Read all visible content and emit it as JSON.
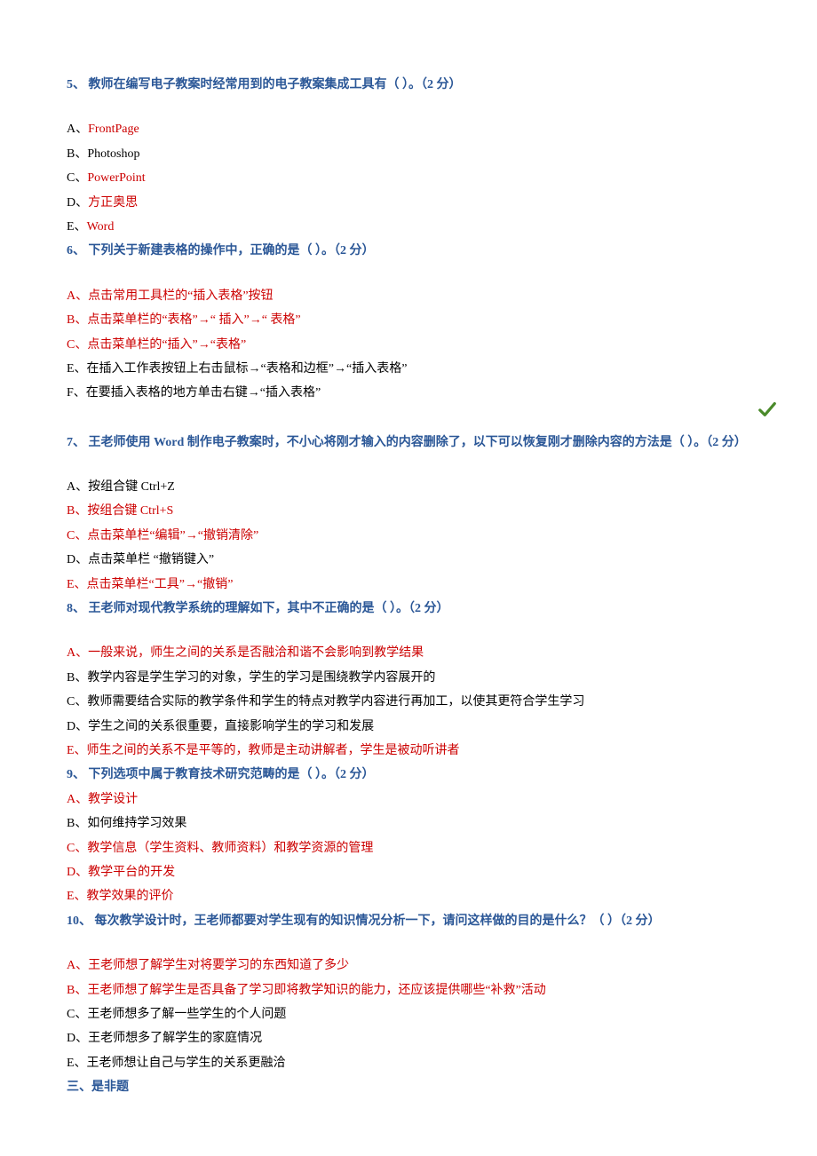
{
  "q5": {
    "header": "5、 教师在编写电子教案时经常用到的电子教案集成工具有（ ）。（2 分）",
    "a": "A、FrontPage",
    "b": "B、Photoshop",
    "c": "C、PowerPoint",
    "d": "D、方正奥思",
    "e": "E、Word"
  },
  "q6": {
    "header": "6、 下列关于新建表格的操作中，正确的是（ ）。（2 分）",
    "a": "A、点击常用工具栏的“插入表格”按钮",
    "b": "B、点击菜单栏的“表格”→“ 插入”→“ 表格”",
    "c": "C、点击菜单栏的“插入”→“表格”",
    "e": "E、在插入工作表按钮上右击鼠标→“表格和边框”→“插入表格”",
    "f": "F、在要插入表格的地方单击右键→“插入表格”"
  },
  "q7": {
    "header": "7、 王老师使用 Word 制作电子教案时，不小心将刚才输入的内容删除了，以下可以恢复刚才删除内容的方法是（ ）。（2 分）",
    "a": "A、按组合键 Ctrl+Z",
    "b": "B、按组合键 Ctrl+S",
    "c": "C、点击菜单栏“编辑”→“撤销清除”",
    "d": "D、点击菜单栏 “撤销键入”",
    "e": "E、点击菜单栏“工具”→“撤销”"
  },
  "q8": {
    "header": "8、 王老师对现代教学系统的理解如下，其中不正确的是（ ）。（2 分）",
    "a": "A、一般来说，师生之间的关系是否融洽和谐不会影响到教学结果",
    "b": "B、教学内容是学生学习的对象，学生的学习是围绕教学内容展开的",
    "c": "C、教师需要结合实际的教学条件和学生的特点对教学内容进行再加工，以使其更符合学生学习",
    "d": "D、学生之间的关系很重要，直接影响学生的学习和发展",
    "e": "E、师生之间的关系不是平等的，教师是主动讲解者，学生是被动听讲者"
  },
  "q9": {
    "header": "9、 下列选项中属于教育技术研究范畴的是（ ）。（2 分）",
    "a": "A、教学设计",
    "b": "B、如何维持学习效果",
    "c": "C、教学信息（学生资料、教师资料）和教学资源的管理",
    "d": "D、教学平台的开发",
    "e": "E、教学效果的评价"
  },
  "q10": {
    "header": "10、 每次教学设计时，王老师都要对学生现有的知识情况分析一下，请问这样做的目的是什么？（ ）（2 分）",
    "a": "A、王老师想了解学生对将要学习的东西知道了多少",
    "b": "B、王老师想了解学生是否具备了学习即将教学知识的能力，还应该提供哪些“补救”活动",
    "c": "C、王老师想多了解一些学生的个人问题",
    "d": "D、王老师想多了解学生的家庭情况",
    "e": "E、王老师想让自己与学生的关系更融洽"
  },
  "section3": "三、是非题"
}
